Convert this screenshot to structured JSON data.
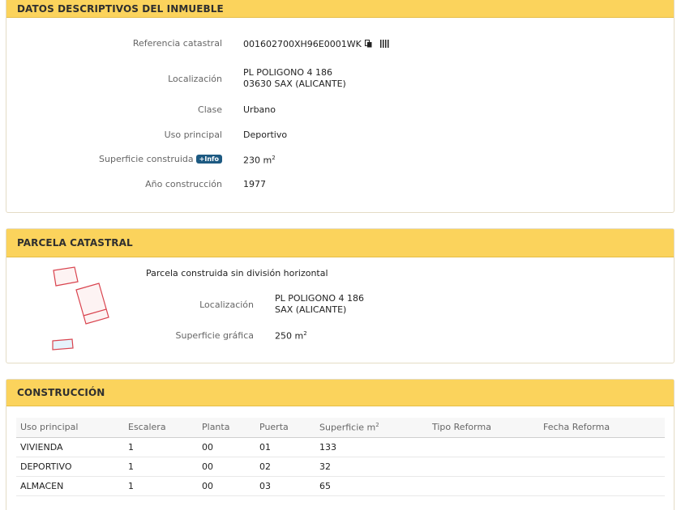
{
  "datos": {
    "title": "DATOS DESCRIPTIVOS DEL INMUEBLE",
    "ref_label": "Referencia catastral",
    "ref_value": "001602700XH96E0001WK",
    "loc_label": "Localización",
    "loc_line1": "PL POLIGONO 4 186",
    "loc_line2": "03630 SAX (ALICANTE)",
    "clase_label": "Clase",
    "clase_value": "Urbano",
    "uso_label": "Uso principal",
    "uso_value": "Deportivo",
    "sup_label": "Superficie construida",
    "info_badge": "+Info",
    "sup_value": "230 m",
    "sup_unit_exp": "2",
    "anio_label": "Año construcción",
    "anio_value": "1977"
  },
  "parcela": {
    "title": "PARCELA CATASTRAL",
    "desc": "Parcela construida sin división horizontal",
    "loc_label": "Localización",
    "loc_line1": "PL POLIGONO 4 186",
    "loc_line2": "SAX (ALICANTE)",
    "sup_label": "Superficie gráfica",
    "sup_value": "250 m",
    "sup_unit_exp": "2"
  },
  "construccion": {
    "title": "CONSTRUCCIÓN",
    "headers": [
      "Uso principal",
      "Escalera",
      "Planta",
      "Puerta",
      "Superficie m",
      "Tipo Reforma",
      "Fecha Reforma"
    ],
    "header_exp": "2",
    "rows": [
      [
        "VIVIENDA",
        "1",
        "00",
        "01",
        "133",
        "",
        ""
      ],
      [
        "DEPORTIVO",
        "1",
        "00",
        "02",
        "32",
        "",
        ""
      ],
      [
        "ALMACEN",
        "1",
        "00",
        "03",
        "65",
        "",
        ""
      ]
    ]
  },
  "icons": {
    "copy": "copy-icon",
    "barcode": "barcode-icon"
  },
  "colors": {
    "header_bg": "#fbd35c",
    "badge_bg": "#1d5a82",
    "parcel_outline": "#d9434e"
  }
}
